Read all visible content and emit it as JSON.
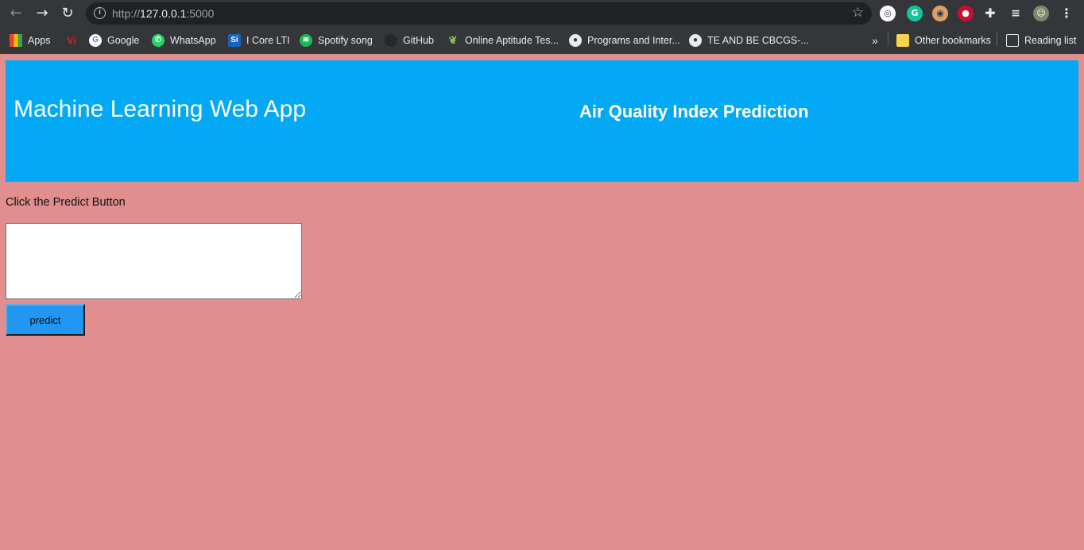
{
  "browser": {
    "url_scheme": "http://",
    "url_host": "127.0.0.1",
    "url_port": ":5000",
    "bookmarks": [
      {
        "label": "Apps",
        "icon": "apps-grid-icon"
      },
      {
        "label": "",
        "icon": "vi-icon"
      },
      {
        "label": "Google",
        "icon": "google-icon"
      },
      {
        "label": "WhatsApp",
        "icon": "whatsapp-icon"
      },
      {
        "label": "I Core LTI",
        "icon": "lti-icon"
      },
      {
        "label": "Spotify song",
        "icon": "spotify-icon"
      },
      {
        "label": "GitHub",
        "icon": "github-icon"
      },
      {
        "label": "Online Aptitude Tes...",
        "icon": "leaf-icon"
      },
      {
        "label": "Programs and Inter...",
        "icon": "globe-icon"
      },
      {
        "label": "TE AND BE CBCGS-...",
        "icon": "globe-icon"
      }
    ],
    "overflow_label": "»",
    "other_bookmarks": "Other bookmarks",
    "reading_list": "Reading list"
  },
  "header": {
    "app_title": "Machine Learning Web App",
    "subtitle": "Air Quality Index Prediction"
  },
  "main": {
    "instruction": "Click the Predict Button",
    "input_value": "",
    "predict_label": "predict"
  },
  "colors": {
    "page_bg": "#e08e8e",
    "header_bg": "#03a9f4",
    "button_bg": "#2196f3",
    "chrome_bg": "#35363a"
  }
}
